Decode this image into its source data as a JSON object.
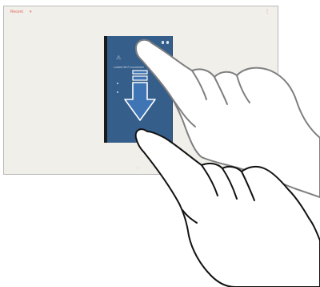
{
  "app": {
    "menu_label": "Recent",
    "menu_caret": "▾",
    "overflow_icon": "⋮",
    "home_indicator": "○"
  },
  "panel": {
    "warning_glyph": "⚠",
    "status_text": "Locked Wi-Fi connected"
  },
  "colors": {
    "accent": "#e0685a",
    "panel": "#365e8a",
    "arrow": "#3f74b5"
  },
  "gesture": {
    "direction": "down",
    "arrow_icon": "arrow-down-icon",
    "fingers": 2
  }
}
